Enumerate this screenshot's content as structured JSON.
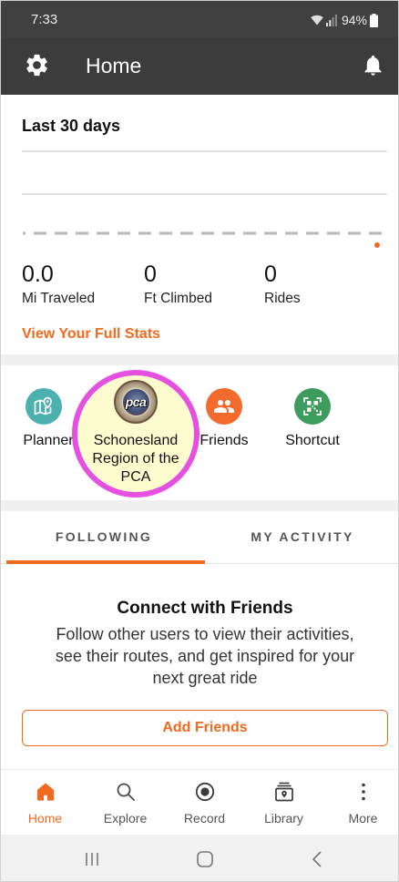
{
  "status_bar": {
    "time": "7:33",
    "battery": "94%",
    "icons": [
      "wifi-icon",
      "signal-icon",
      "battery-icon"
    ]
  },
  "app_bar": {
    "title": "Home",
    "left_icon": "gear-icon",
    "right_icon": "bell-icon"
  },
  "stats": {
    "period": "Last 30 days",
    "items": [
      {
        "value": "0.0",
        "label": "Mi Traveled"
      },
      {
        "value": "0",
        "label": "Ft Climbed"
      },
      {
        "value": "0",
        "label": "Rides"
      }
    ],
    "link": "View Your Full Stats"
  },
  "shortcuts": [
    {
      "label": "Planner",
      "icon": "map-pin-icon",
      "color": "#4bb0ae"
    },
    {
      "label": "Schonesland Region of the PCA",
      "icon": "pca-logo",
      "logo_text": "pca",
      "highlighted": true
    },
    {
      "label": "Friends",
      "icon": "people-icon",
      "color": "#f26b2c"
    },
    {
      "label": "Shortcut",
      "icon": "qr-code-icon",
      "color": "#3d9c5d"
    }
  ],
  "tabs": [
    {
      "label": "FOLLOWING",
      "active": true
    },
    {
      "label": "MY ACTIVITY",
      "active": false
    }
  ],
  "empty_state": {
    "title": "Connect with Friends",
    "body": "Follow other users to view their activities, see their routes, and get inspired for your next great ride",
    "button": "Add Friends"
  },
  "bottom_nav": [
    {
      "label": "Home",
      "icon": "home-icon",
      "active": true
    },
    {
      "label": "Explore",
      "icon": "search-icon",
      "active": false
    },
    {
      "label": "Record",
      "icon": "record-icon",
      "active": false
    },
    {
      "label": "Library",
      "icon": "library-icon",
      "active": false
    },
    {
      "label": "More",
      "icon": "more-vertical-icon",
      "active": false
    }
  ],
  "system_nav": {
    "icons": [
      "recent-apps-icon",
      "home-button-icon",
      "back-icon"
    ]
  },
  "colors": {
    "accent": "#f26a1f",
    "app_bar": "#3c3c3c",
    "highlight_ring": "#e650e0",
    "highlight_fill": "#fdfccf"
  }
}
